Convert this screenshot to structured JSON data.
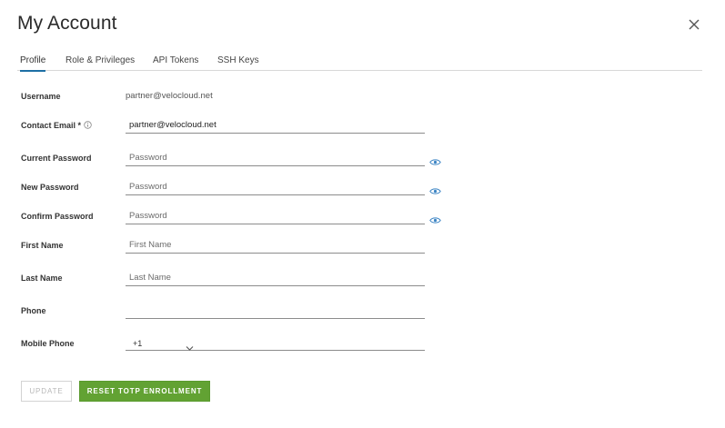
{
  "dialog": {
    "title": "My Account",
    "close_icon": "close-icon"
  },
  "tabs": [
    {
      "label": "Profile",
      "active": true
    },
    {
      "label": "Role & Privileges",
      "active": false
    },
    {
      "label": "API Tokens",
      "active": false
    },
    {
      "label": "SSH Keys",
      "active": false
    }
  ],
  "form": {
    "username": {
      "label": "Username",
      "value": "partner@velocloud.net"
    },
    "contact_email": {
      "label": "Contact Email *",
      "value": "partner@velocloud.net",
      "icon": "info-icon"
    },
    "current_password": {
      "label": "Current Password",
      "placeholder": "Password",
      "icon": "eye-icon"
    },
    "new_password": {
      "label": "New Password",
      "placeholder": "Password",
      "icon": "eye-icon"
    },
    "confirm_password": {
      "label": "Confirm Password",
      "placeholder": "Password",
      "icon": "eye-icon"
    },
    "first_name": {
      "label": "First Name",
      "placeholder": "First Name"
    },
    "last_name": {
      "label": "Last Name",
      "placeholder": "Last Name"
    },
    "phone": {
      "label": "Phone",
      "placeholder": ""
    },
    "mobile_phone": {
      "label": "Mobile Phone",
      "country_code": "+1",
      "icon": "chevron-down-icon"
    }
  },
  "buttons": {
    "update": "UPDATE",
    "reset_totp": "RESET TOTP ENROLLMENT"
  },
  "colors": {
    "accent": "#1d6fa5",
    "primary_button": "#62a233",
    "eye_icon": "#3b84c4"
  }
}
